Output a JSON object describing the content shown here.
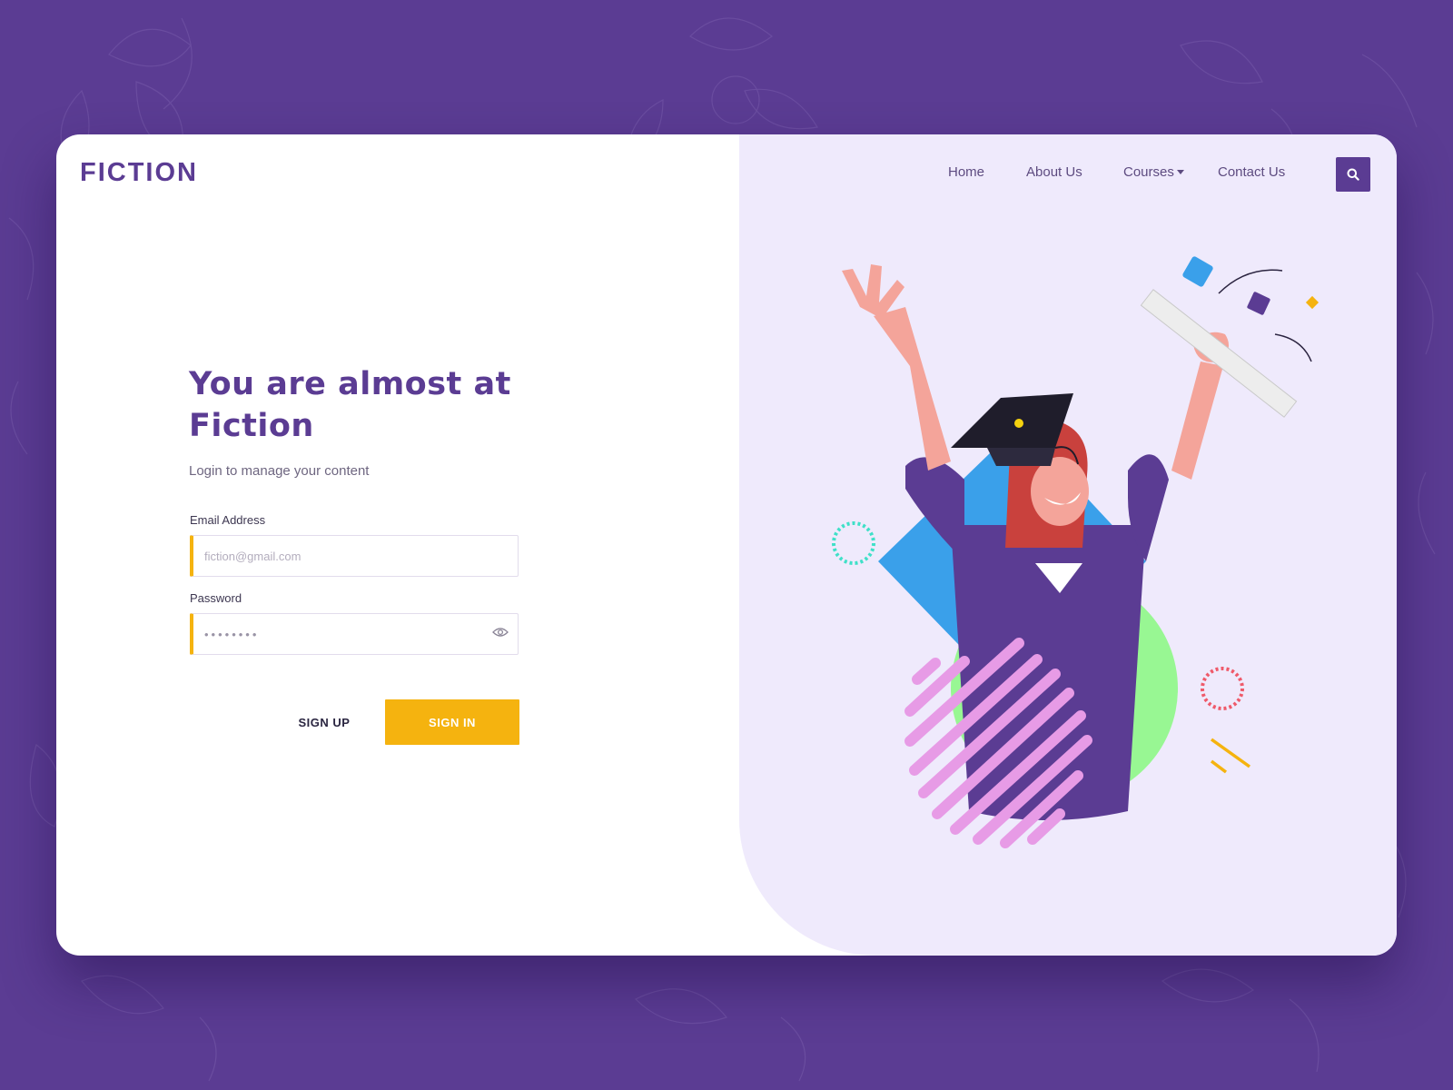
{
  "brand": {
    "logo_text": "FICTION"
  },
  "nav": {
    "items": [
      {
        "label": "Home"
      },
      {
        "label": "About Us"
      },
      {
        "label": "Courses",
        "has_dropdown": true
      },
      {
        "label": "Contact Us"
      }
    ],
    "search_icon": "search-icon"
  },
  "login": {
    "heading": "You are almost at Fiction",
    "subtitle": "Login to manage your content",
    "email": {
      "label": "Email Address",
      "placeholder": "fiction@gmail.com",
      "value": ""
    },
    "password": {
      "label": "Password",
      "value": "••••••••",
      "toggle_icon": "eye-icon"
    },
    "signup_label": "SIGN UP",
    "signin_label": "SIGN IN"
  },
  "colors": {
    "background": "#5b3c93",
    "brand_purple": "#5b3c93",
    "accent_yellow": "#f5b30f",
    "panel_lavender": "#efeafc",
    "card": "#ffffff"
  }
}
